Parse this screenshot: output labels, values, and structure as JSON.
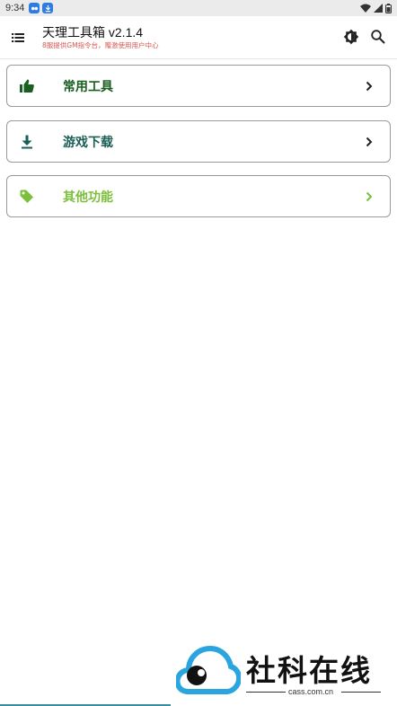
{
  "status_bar": {
    "time": "9:34"
  },
  "app_bar": {
    "title": "天理工具箱 v2.1.4",
    "subtitle": "8服提供GM指令台，赠激使用用户中心"
  },
  "menu": [
    {
      "label": "常用工具",
      "icon": "thumbs-up-icon",
      "color": "#1a5e20"
    },
    {
      "label": "游戏下载",
      "icon": "download-icon",
      "color": "#1b5e55"
    },
    {
      "label": "其他功能",
      "icon": "tag-icon",
      "color": "#7cbf3a"
    }
  ],
  "watermark": {
    "text": "社科在线",
    "domain": "cass.com.cn"
  },
  "colors": {
    "cloud_blue": "#2aa5df",
    "subtitle_red": "#d9544f"
  }
}
